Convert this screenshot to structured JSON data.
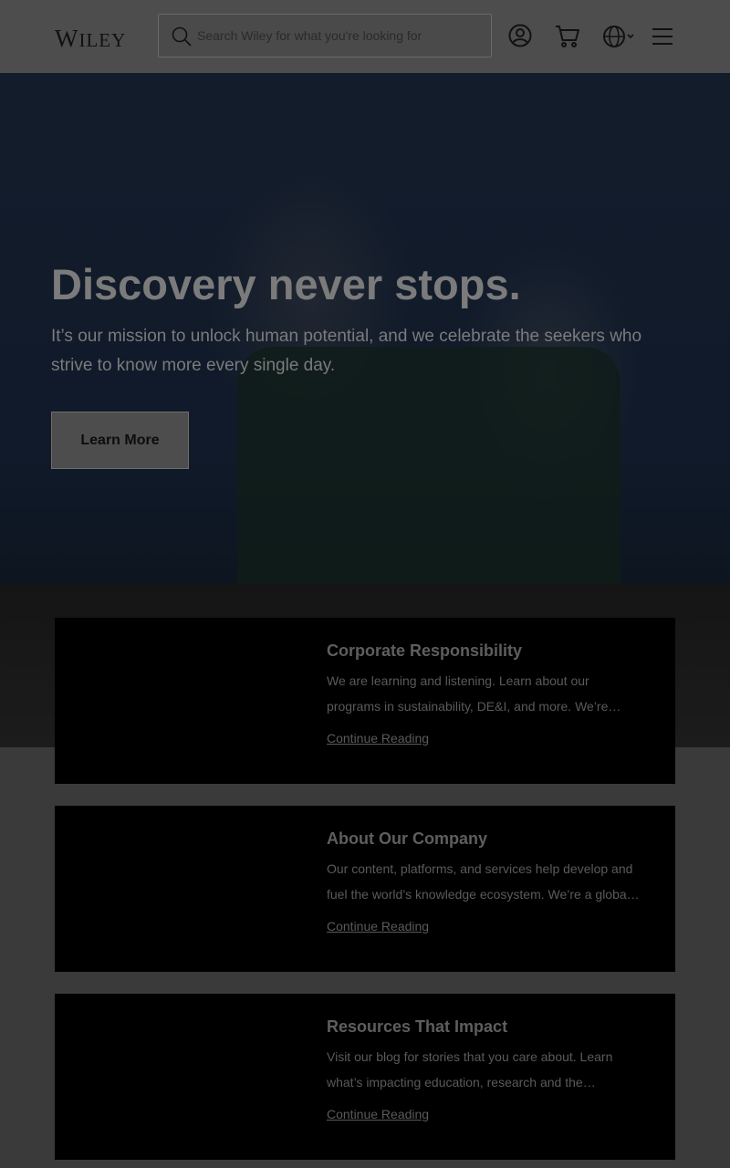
{
  "header": {
    "logo_text": "Wiley",
    "search_placeholder": "Search Wiley for what you're looking for",
    "icons": [
      "user-account-icon",
      "cart-icon",
      "globe-icon",
      "menu-icon"
    ]
  },
  "hero": {
    "title": "Discovery never stops.",
    "subtitle": "It’s our mission to unlock human potential, and we celebrate the seekers who strive to know more every single day.",
    "button_label": "Learn More"
  },
  "cards": [
    {
      "title": "Corporate Responsibility",
      "text": "We are learning and listening. Learn about our programs in sustainability, DE&I, and more. We’re…",
      "link": "Continue Reading"
    },
    {
      "title": "About Our Company",
      "text": "Our content, platforms, and services help develop and fuel the world’s knowledge ecosystem. We’re a globa…",
      "link": "Continue Reading"
    },
    {
      "title": "Resources That Impact",
      "text": "Visit our blog for stories that you care about. Learn what’s impacting education, research and the…",
      "link": "Continue Reading"
    }
  ],
  "colors": {
    "overlay": "#000000",
    "header_bg": "#4d4d4d",
    "card_bg": "#000000"
  }
}
